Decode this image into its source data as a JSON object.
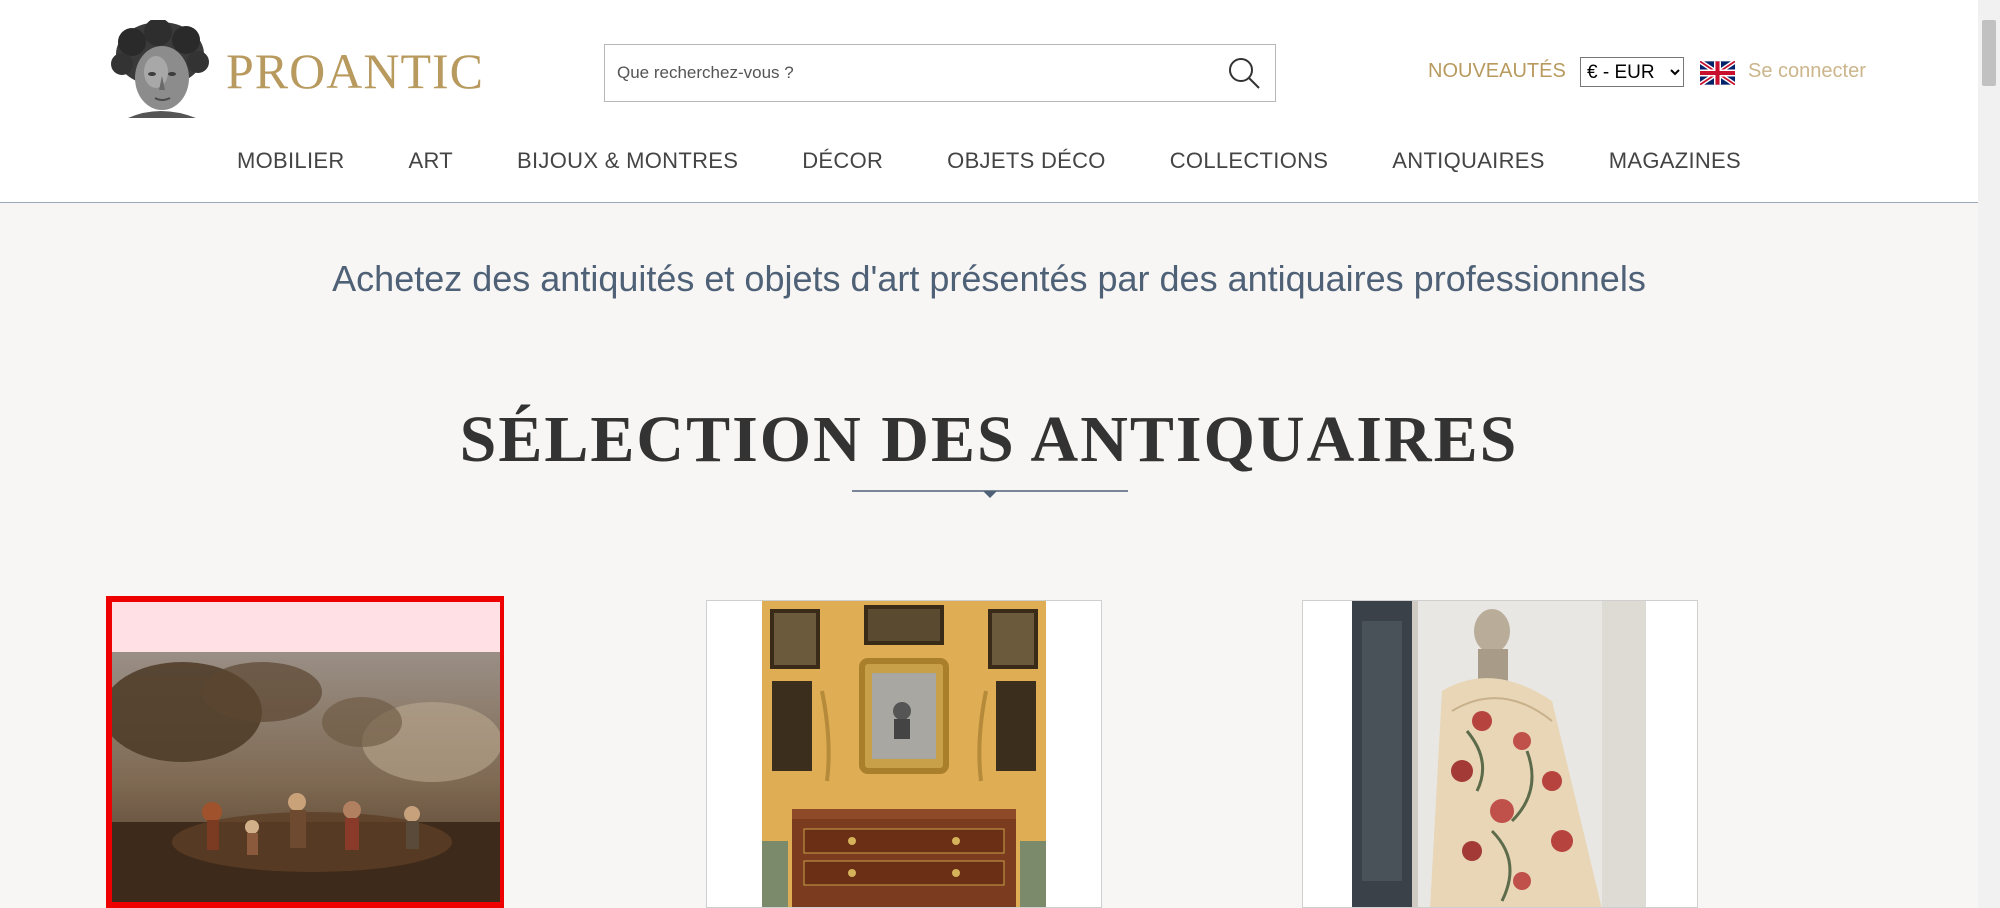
{
  "header": {
    "brand": "PROANTIC",
    "search_placeholder": "Que recherchez-vous ?",
    "new_label": "NOUVEAUTÉS",
    "currency": {
      "selected": "€ - EUR",
      "options": [
        "€ - EUR"
      ]
    },
    "login_label": "Se connecter"
  },
  "nav": {
    "items": [
      {
        "label": "MOBILIER"
      },
      {
        "label": "ART"
      },
      {
        "label": "BIJOUX & MONTRES"
      },
      {
        "label": "DÉCOR"
      },
      {
        "label": "OBJETS DÉCO"
      },
      {
        "label": "COLLECTIONS"
      },
      {
        "label": "ANTIQUAIRES"
      },
      {
        "label": "MAGAZINES"
      }
    ]
  },
  "main": {
    "tagline": "Achetez des antiquités et objets d'art présentés par des antiquaires professionnels",
    "section_title": "SÉLECTION DES ANTIQUAIRES"
  },
  "colors": {
    "gold": "#b89a5e",
    "login": "#cbb58b",
    "tagline": "#4f6177",
    "highlight": "#ee0000"
  }
}
